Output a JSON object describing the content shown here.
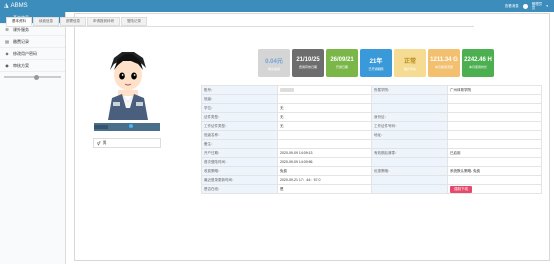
{
  "header": {
    "app_title": "ABMS",
    "right_link": "查看消息",
    "user_line1": "管理员",
    "user_line2": "员"
  },
  "sidebar": {
    "items": [
      {
        "label": "基本信息",
        "icon": "user-icon",
        "active": true
      },
      {
        "label": "课外服务",
        "icon": "list-icon",
        "active": false
      },
      {
        "label": "缴费记录",
        "icon": "record-icon",
        "active": false
      },
      {
        "label": "修改用户密码",
        "icon": "lock-icon",
        "active": false
      },
      {
        "label": "审核方案",
        "icon": "audit-icon",
        "active": false
      }
    ]
  },
  "tabs": [
    {
      "label": "基本资料",
      "active": true
    },
    {
      "label": "续费信息",
      "active": false
    },
    {
      "label": "部寮信息",
      "active": false
    },
    {
      "label": "申请报到科研",
      "active": false
    },
    {
      "label": "登陆记录",
      "active": false
    }
  ],
  "profile": {
    "status_strip_text": "",
    "gender_icon": "male-female-icon",
    "gender": "男"
  },
  "cards": [
    {
      "value": "0.04元",
      "label": "剩余金额",
      "color": "#d5d5d5",
      "text_color": "#6fa3d8"
    },
    {
      "value": "21/10/25",
      "label": "费用有效日期",
      "color": "#6d6d6d",
      "text_color": "#ffffff"
    },
    {
      "value": "26/09/21",
      "label": "开通日期",
      "color": "#7ab648",
      "text_color": "#ffffff"
    },
    {
      "value": "21年",
      "label": "已开通期限",
      "color": "#3a9ad9",
      "text_color": "#ffffff"
    },
    {
      "value": "正常",
      "label": "账户状态",
      "color": "#f6dc92",
      "text_color": "#b68b1e"
    },
    {
      "value": "1211.34 G",
      "label": "本月使用流量",
      "color": "#f3c070",
      "text_color": "#ffffff"
    },
    {
      "value": "2242.46 H",
      "label": "本月使用时长",
      "color": "#4caf50",
      "text_color": "#ffffff"
    }
  ],
  "info_rows": [
    [
      "账号：",
      "",
      "所属学院：",
      "广州体育学院"
    ],
    [
      "班级：",
      "",
      "",
      ""
    ],
    [
      "学位：",
      "无",
      "",
      ""
    ],
    [
      "证件类型：",
      "无",
      "身份证：",
      ""
    ],
    [
      "工作证件类型：",
      "无",
      "工作证件号码：",
      ""
    ],
    [
      "班级名称：",
      "",
      "地址：",
      ""
    ],
    [
      "备注：",
      "",
      "",
      ""
    ],
    [
      "开户日期：",
      "2020-09-09 14:09:13",
      "有效期后清零：",
      "已启用"
    ],
    [
      "首次登陆时间：",
      "2020-09-09 14:09:56",
      "",
      ""
    ],
    [
      "收费策略：",
      "免费",
      "优惠策略：",
      "系统默认策略- 免费"
    ],
    [
      "最近登录更新时间：",
      "2020-09-21 17：44：57.0",
      "",
      ""
    ],
    [
      "是否在线：",
      "是",
      "",
      "强制下线"
    ]
  ]
}
